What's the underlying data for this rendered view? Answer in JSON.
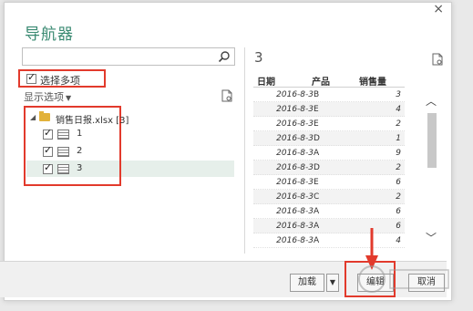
{
  "dialog": {
    "title": "导航器",
    "close_glyph": "×"
  },
  "left_panel": {
    "search": {
      "placeholder": "",
      "value": ""
    },
    "multi_select": {
      "label": "选择多项",
      "checked": true
    },
    "display_options": {
      "label": "显示选项",
      "arrow": "▼"
    },
    "tree": {
      "root": {
        "expand_glyph": "◢",
        "name": "销售日报.xlsx [3]"
      },
      "sheets": [
        {
          "name": "1",
          "checked": true
        },
        {
          "name": "2",
          "checked": true
        },
        {
          "name": "3",
          "checked": true,
          "selected": true
        }
      ]
    }
  },
  "preview": {
    "title": "3",
    "columns": [
      "日期",
      "产品",
      "销售量"
    ],
    "rows": [
      [
        "2016-8-3",
        "B",
        "3"
      ],
      [
        "2016-8-3",
        "E",
        "4"
      ],
      [
        "2016-8-3",
        "E",
        "2"
      ],
      [
        "2016-8-3",
        "D",
        "1"
      ],
      [
        "2016-8-3",
        "A",
        "9"
      ],
      [
        "2016-8-3",
        "D",
        "2"
      ],
      [
        "2016-8-3",
        "E",
        "6"
      ],
      [
        "2016-8-3",
        "C",
        "2"
      ],
      [
        "2016-8-3",
        "A",
        "6"
      ],
      [
        "2016-8-3",
        "A",
        "6"
      ],
      [
        "2016-8-3",
        "A",
        "4"
      ]
    ]
  },
  "footer": {
    "load_label": "加载",
    "load_dropdown": "▼",
    "edit_label": "编辑",
    "cancel_label": "取消"
  },
  "colors": {
    "title_green": "#3a8a72",
    "highlight_red": "#e23a2c",
    "selected_row": "#e6efea"
  }
}
